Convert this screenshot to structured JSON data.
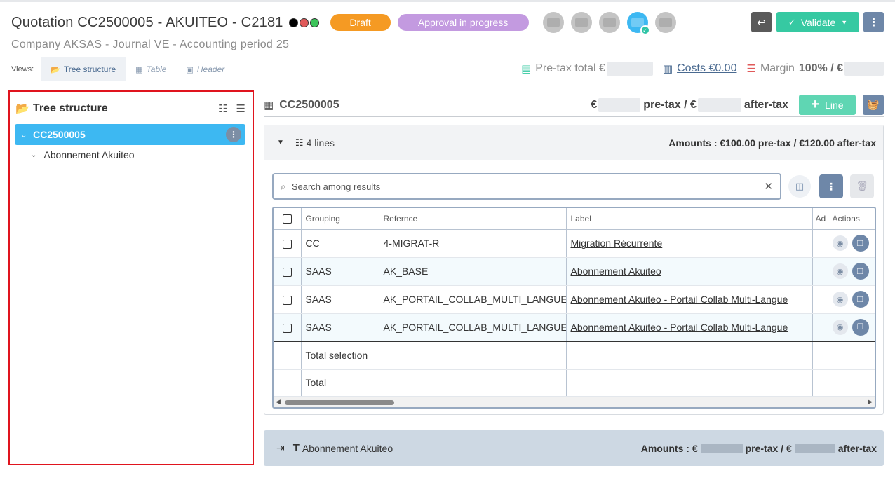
{
  "header": {
    "title": "Quotation  CC2500005  -  AKUITEO  - C2181",
    "subtitle": "Company AKSAS  -   Journal VE  -   Accounting period 25",
    "status_dots": [
      "#000000",
      "#e05a5a",
      "#3cc45a"
    ],
    "badges": [
      {
        "label": "Draft",
        "color": "#f59a23"
      },
      {
        "label": "Approval in progress",
        "color": "#c39ae0"
      }
    ],
    "avatars_count": 5,
    "validate_label": "Validate"
  },
  "views": {
    "label": "Views:",
    "tabs": [
      {
        "label": "Tree structure",
        "icon": "folder-open-icon",
        "active": true
      },
      {
        "label": "Table",
        "icon": "table-icon",
        "active": false
      },
      {
        "label": "Header",
        "icon": "file-header-icon",
        "active": false
      }
    ]
  },
  "totals": {
    "pretax_label": "Pre-tax total €",
    "costs_label": "Costs €0.00",
    "margin_label": "Margin",
    "margin_value": "100% / €"
  },
  "tree": {
    "title": "Tree structure",
    "root_label": "CC2500005",
    "child_label": "Abonnement Akuiteo"
  },
  "main": {
    "code": "CC2500005",
    "euro": "€",
    "pretax_suffix": "pre-tax / €",
    "aftertax_suffix": "after-tax",
    "line_button": "Line",
    "group1": {
      "lines_count": "4 lines",
      "amounts": "Amounts : €100.00 pre-tax / €120.00 after-tax"
    },
    "search_placeholder": "Search among results",
    "columns": [
      "Grouping",
      "Refernce",
      "Label",
      "Ad",
      "Actions"
    ],
    "rows": [
      {
        "grouping": "CC",
        "reference": "4-MIGRAT-R",
        "label": "Migration Récurrente"
      },
      {
        "grouping": "SAAS",
        "reference": "AK_BASE",
        "label": "Abonnement Akuiteo"
      },
      {
        "grouping": "SAAS",
        "reference": "AK_PORTAIL_COLLAB_MULTI_LANGUE",
        "label": "Abonnement Akuiteo - Portail Collab Multi-Langue"
      },
      {
        "grouping": "SAAS",
        "reference": "AK_PORTAIL_COLLAB_MULTI_LANGUE",
        "label": "Abonnement Akuiteo - Portail Collab Multi-Langue"
      }
    ],
    "total_selection_label": "Total selection",
    "total_label": "Total",
    "group2": {
      "name": "Abonnement Akuiteo",
      "amounts_prefix": "Amounts : €",
      "pretax_suffix": "pre-tax / €",
      "aftertax_suffix": "after-tax"
    }
  }
}
